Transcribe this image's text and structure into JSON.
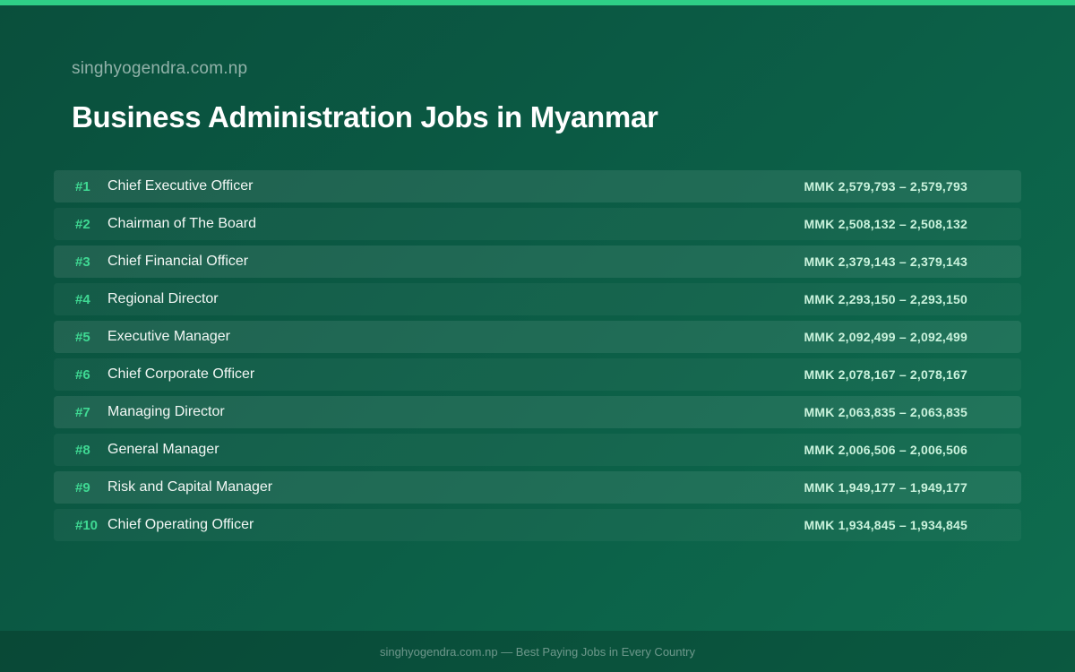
{
  "colors": {
    "accent": "#2ecf86",
    "rank": "#3fd993",
    "background_start": "#0a4f3c",
    "background_end": "#0e6d4f"
  },
  "header": {
    "site_name": "singhyogendra.com.np",
    "title": "Business Administration Jobs in Myanmar"
  },
  "jobs": [
    {
      "rank": "#1",
      "title": "Chief Executive Officer",
      "salary": "MMK 2,579,793 – 2,579,793"
    },
    {
      "rank": "#2",
      "title": "Chairman of The Board",
      "salary": "MMK 2,508,132 – 2,508,132"
    },
    {
      "rank": "#3",
      "title": "Chief Financial Officer",
      "salary": "MMK 2,379,143 – 2,379,143"
    },
    {
      "rank": "#4",
      "title": "Regional Director",
      "salary": "MMK 2,293,150 – 2,293,150"
    },
    {
      "rank": "#5",
      "title": "Executive Manager",
      "salary": "MMK 2,092,499 – 2,092,499"
    },
    {
      "rank": "#6",
      "title": "Chief Corporate Officer",
      "salary": "MMK 2,078,167 – 2,078,167"
    },
    {
      "rank": "#7",
      "title": "Managing Director",
      "salary": "MMK 2,063,835 – 2,063,835"
    },
    {
      "rank": "#8",
      "title": "General Manager",
      "salary": "MMK 2,006,506 – 2,006,506"
    },
    {
      "rank": "#9",
      "title": "Risk and Capital Manager",
      "salary": "MMK 1,949,177 – 1,949,177"
    },
    {
      "rank": "#10",
      "title": "Chief Operating Officer",
      "salary": "MMK 1,934,845 – 1,934,845"
    }
  ],
  "footer": {
    "text": "singhyogendra.com.np — Best Paying Jobs in Every Country"
  }
}
